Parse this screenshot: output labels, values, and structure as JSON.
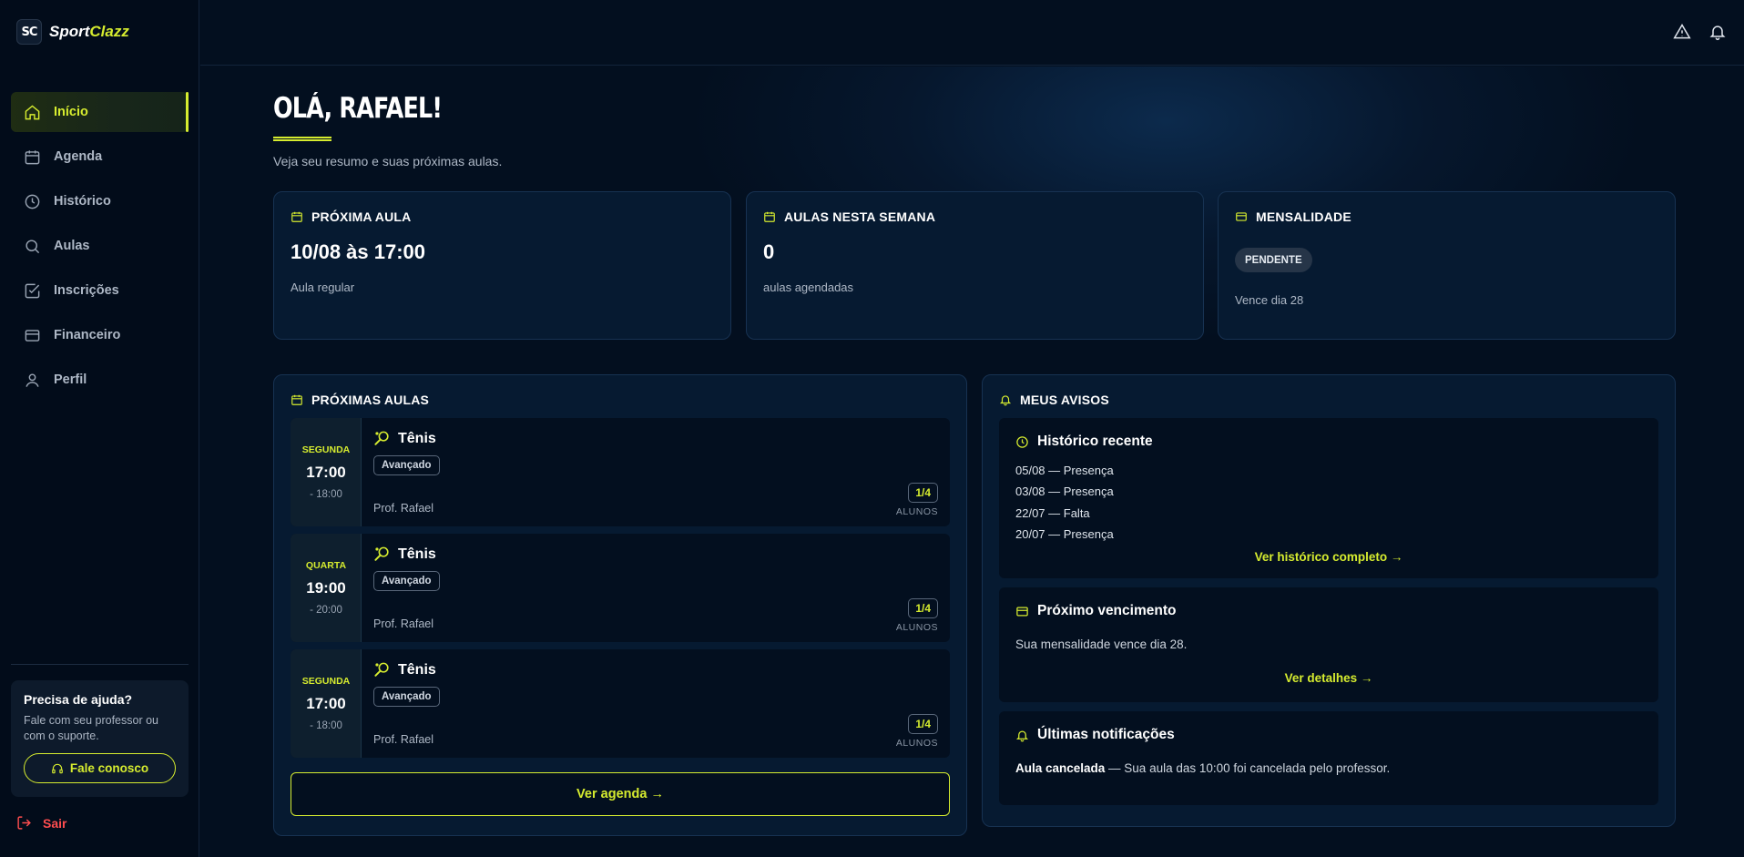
{
  "app": {
    "logo_mark": "SC",
    "logo_part1": "Sport",
    "logo_part2": "Clazz"
  },
  "sidebar": {
    "items": [
      {
        "label": "Início",
        "icon": "home-icon",
        "active": true
      },
      {
        "label": "Agenda",
        "icon": "calendar-icon"
      },
      {
        "label": "Histórico",
        "icon": "clock-icon"
      },
      {
        "label": "Aulas",
        "icon": "search-icon"
      },
      {
        "label": "Inscrições",
        "icon": "check-square-icon"
      },
      {
        "label": "Financeiro",
        "icon": "credit-card-icon"
      },
      {
        "label": "Perfil",
        "icon": "user-icon"
      }
    ],
    "help": {
      "title": "Precisa de ajuda?",
      "text": "Fale com seu professor ou com o suporte.",
      "button": "Fale conosco"
    },
    "logout": "Sair"
  },
  "topbar": {
    "icons": [
      "alert-triangle-icon",
      "bell-icon"
    ]
  },
  "header": {
    "greeting": "OLÁ, RAFAEL!",
    "subtitle": "Veja seu resumo e suas próximas aulas."
  },
  "stats": {
    "next_class": {
      "title": "PRÓXIMA AULA",
      "value": "10/08 às 17:00",
      "sub": "Aula regular"
    },
    "week": {
      "title": "AULAS NESTA SEMANA",
      "value": "0",
      "sub": "aulas agendadas"
    },
    "fee": {
      "title": "MENSALIDADE",
      "status": "PENDENTE",
      "sub": "Vence dia 28"
    }
  },
  "upcoming": {
    "title": "PRÓXIMAS AULAS",
    "classes": [
      {
        "day": "SEGUNDA",
        "start": "17:00",
        "end": "- 18:00",
        "name": "Tênis",
        "level": "Avançado",
        "teacher": "Prof. Rafael",
        "count": "1/4",
        "count_label": "ALUNOS"
      },
      {
        "day": "QUARTA",
        "start": "19:00",
        "end": "- 20:00",
        "name": "Tênis",
        "level": "Avançado",
        "teacher": "Prof. Rafael",
        "count": "1/4",
        "count_label": "ALUNOS"
      },
      {
        "day": "SEGUNDA",
        "start": "17:00",
        "end": "- 18:00",
        "name": "Tênis",
        "level": "Avançado",
        "teacher": "Prof. Rafael",
        "count": "1/4",
        "count_label": "ALUNOS"
      }
    ],
    "button": "Ver agenda →"
  },
  "notices": {
    "title": "MEUS AVISOS",
    "history": {
      "title": "Histórico recente",
      "entries": [
        "05/08 — Presença",
        "03/08 — Presença",
        "22/07 — Falta",
        "20/07 — Presença"
      ],
      "link": "Ver histórico completo →"
    },
    "due": {
      "title": "Próximo vencimento",
      "text": "Sua mensalidade vence dia 28.",
      "link": "Ver detalhes →"
    },
    "notifications": {
      "title": "Últimas notificações",
      "bold": "Aula cancelada",
      "text": " — Sua aula das 10:00 foi cancelada pelo professor."
    }
  },
  "colors": {
    "accent": "#d6ec2f",
    "background": "#030f1f",
    "card": "#061a31",
    "danger": "#ff4d4f"
  }
}
